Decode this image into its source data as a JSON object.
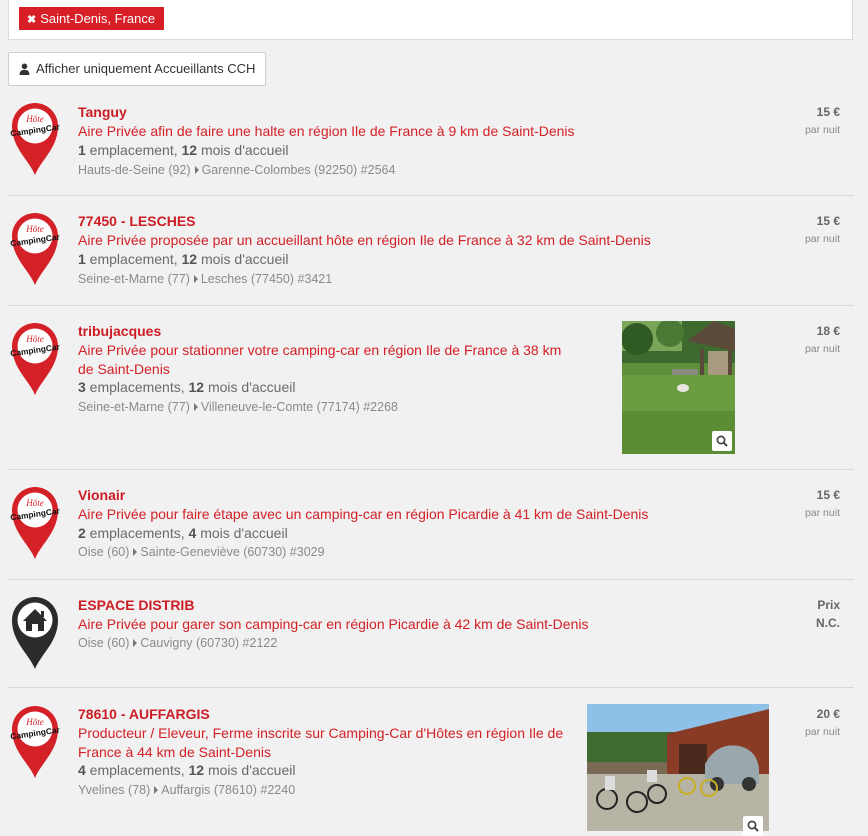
{
  "filter": {
    "icon": "close-icon",
    "label": "Saint-Denis, France"
  },
  "cch_button": {
    "icon": "user-icon",
    "label": "Afficher uniquement Accueillants CCH"
  },
  "listings": [
    {
      "pin": "camping-car-pin",
      "pin_text_top": "Hôte",
      "pin_text_main": "CampingCar",
      "title": "Tanguy",
      "description": "Aire Privée afin de faire une halte en région Ile de France à 9 km de Saint-Denis",
      "emplacements_count": "1",
      "emplacements_label": " emplacement, ",
      "mois_count": "12",
      "mois_label": " mois d'accueil",
      "department": "Hauts-de-Seine (92)",
      "town": "Garenne-Colombes (92250) #2564",
      "price": "15 €",
      "unit": "par nuit"
    },
    {
      "pin": "camping-car-pin",
      "pin_text_top": "Hôte",
      "pin_text_main": "CampingCar",
      "title": "77450 - LESCHES",
      "description": "Aire Privée proposée par un accueillant hôte en région Ile de France à 32 km de Saint-Denis",
      "emplacements_count": "1",
      "emplacements_label": " emplacement, ",
      "mois_count": "12",
      "mois_label": " mois d'accueil",
      "department": "Seine-et-Marne (77)",
      "town": "Lesches (77450) #3421",
      "price": "15 €",
      "unit": "par nuit"
    },
    {
      "pin": "camping-car-pin",
      "pin_text_top": "Hôte",
      "pin_text_main": "CampingCar",
      "title": "tribujacques",
      "description": "Aire Privée pour stationner votre camping-car en région Ile de France à 38 km de Saint-Denis",
      "emplacements_count": "3",
      "emplacements_label": " emplacements, ",
      "mois_count": "12",
      "mois_label": " mois d'accueil",
      "department": "Seine-et-Marne (77)",
      "town": "Villeneuve-le-Comte (77174) #2268",
      "price": "18 €",
      "unit": "par nuit",
      "photo": "garden-gazebo-photo"
    },
    {
      "pin": "camping-car-pin",
      "pin_text_top": "Hôte",
      "pin_text_main": "CampingCar",
      "title": "Vionair",
      "description": "Aire Privée pour faire étape avec un camping-car en région Picardie à 41 km de Saint-Denis",
      "emplacements_count": "2",
      "emplacements_label": " emplacements, ",
      "mois_count": "4",
      "mois_label": " mois d'accueil",
      "department": "Oise (60)",
      "town": "Sainte-Geneviève (60730) #3029",
      "price": "15 €",
      "unit": "par nuit"
    },
    {
      "pin": "house-pin",
      "title": "ESPACE DISTRIB",
      "description": "Aire Privée pour garer son camping-car en région Picardie à 42 km de Saint-Denis",
      "department": "Oise (60)",
      "town": "Cauvigny (60730) #2122",
      "price_line1": "Prix",
      "price_line2": "N.C."
    },
    {
      "pin": "camping-car-pin",
      "pin_text_top": "Hôte",
      "pin_text_main": "CampingCar",
      "title": "78610 - AUFFARGIS",
      "description": "Producteur / Eleveur, Ferme inscrite sur Camping-Car d'Hôtes en région Ile de France à 44 km de Saint-Denis",
      "emplacements_count": "4",
      "emplacements_label": " emplacements, ",
      "mois_count": "12",
      "mois_label": " mois d'accueil",
      "department": "Yvelines (78)",
      "town": "Auffargis (78610) #2240",
      "price": "20 €",
      "unit": "par nuit",
      "photo": "farm-bikes-2cv-photo"
    }
  ],
  "colors": {
    "accent": "#d81e27",
    "title": "#cc1c24",
    "house_pin": "#2b2b2b"
  },
  "zoom_icon": "search-icon"
}
